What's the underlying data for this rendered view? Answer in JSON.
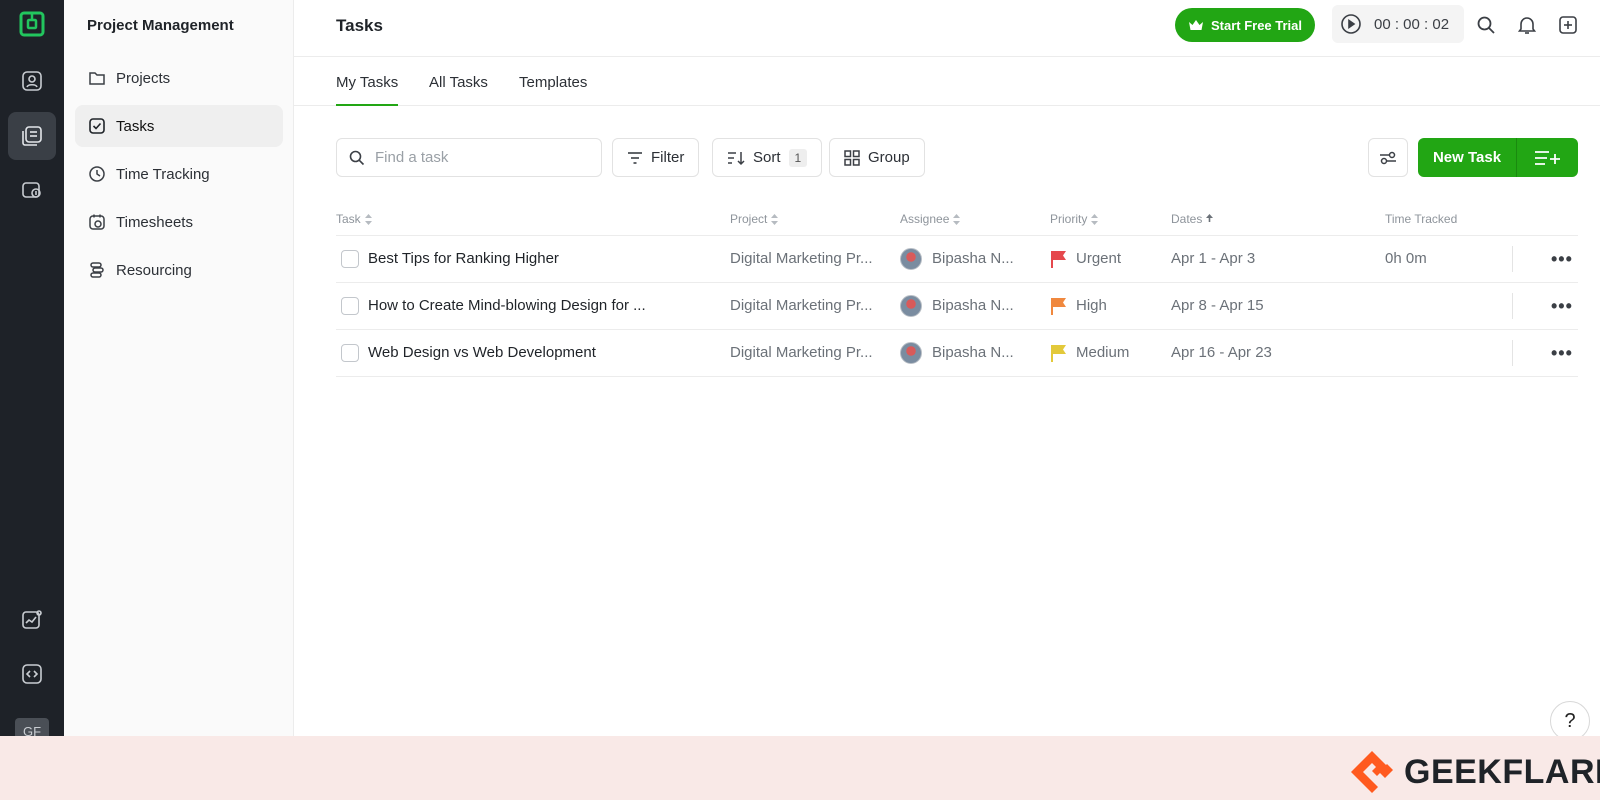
{
  "app": {
    "section_title": "Project Management",
    "page_title": "Tasks",
    "user_initials": "GF"
  },
  "sidebar": {
    "items": [
      {
        "label": "Projects",
        "icon": "folder-icon",
        "active": false
      },
      {
        "label": "Tasks",
        "icon": "checkbox-icon",
        "active": true
      },
      {
        "label": "Time Tracking",
        "icon": "clock-icon",
        "active": false
      },
      {
        "label": "Timesheets",
        "icon": "timesheet-icon",
        "active": false
      },
      {
        "label": "Resourcing",
        "icon": "resourcing-icon",
        "active": false
      }
    ]
  },
  "header": {
    "trial_label": "Start Free Trial",
    "timer_value": "00 : 00 : 02"
  },
  "tabs": [
    {
      "label": "My Tasks",
      "active": true
    },
    {
      "label": "All Tasks",
      "active": false
    },
    {
      "label": "Templates",
      "active": false
    }
  ],
  "toolbar": {
    "search_placeholder": "Find a task",
    "filter_label": "Filter",
    "sort_label": "Sort",
    "sort_count": "1",
    "group_label": "Group",
    "new_task_label": "New Task"
  },
  "table": {
    "columns": [
      "Task",
      "Project",
      "Assignee",
      "Priority",
      "Dates",
      "Time Tracked"
    ],
    "rows": [
      {
        "task": "Best Tips for Ranking Higher",
        "project": "Digital Marketing Pr...",
        "assignee": "Bipasha N...",
        "priority": "Urgent",
        "priority_color": "#e5484d",
        "dates": "Apr 1 - Apr 3",
        "time_tracked": "0h 0m"
      },
      {
        "task": "How to Create Mind-blowing Design for ...",
        "project": "Digital Marketing Pr...",
        "assignee": "Bipasha N...",
        "priority": "High",
        "priority_color": "#f0883e",
        "dates": "Apr 8 - Apr 15",
        "time_tracked": ""
      },
      {
        "task": "Web Design vs Web Development",
        "project": "Digital Marketing Pr...",
        "assignee": "Bipasha N...",
        "priority": "Medium",
        "priority_color": "#e3c93a",
        "dates": "Apr 16 - Apr 23",
        "time_tracked": ""
      }
    ]
  },
  "help_label": "?",
  "watermark": {
    "brand": "GEEKFLARE",
    "accent": "#ff5a1f"
  },
  "colors": {
    "accent": "#22a614",
    "rail": "#1e2228"
  }
}
